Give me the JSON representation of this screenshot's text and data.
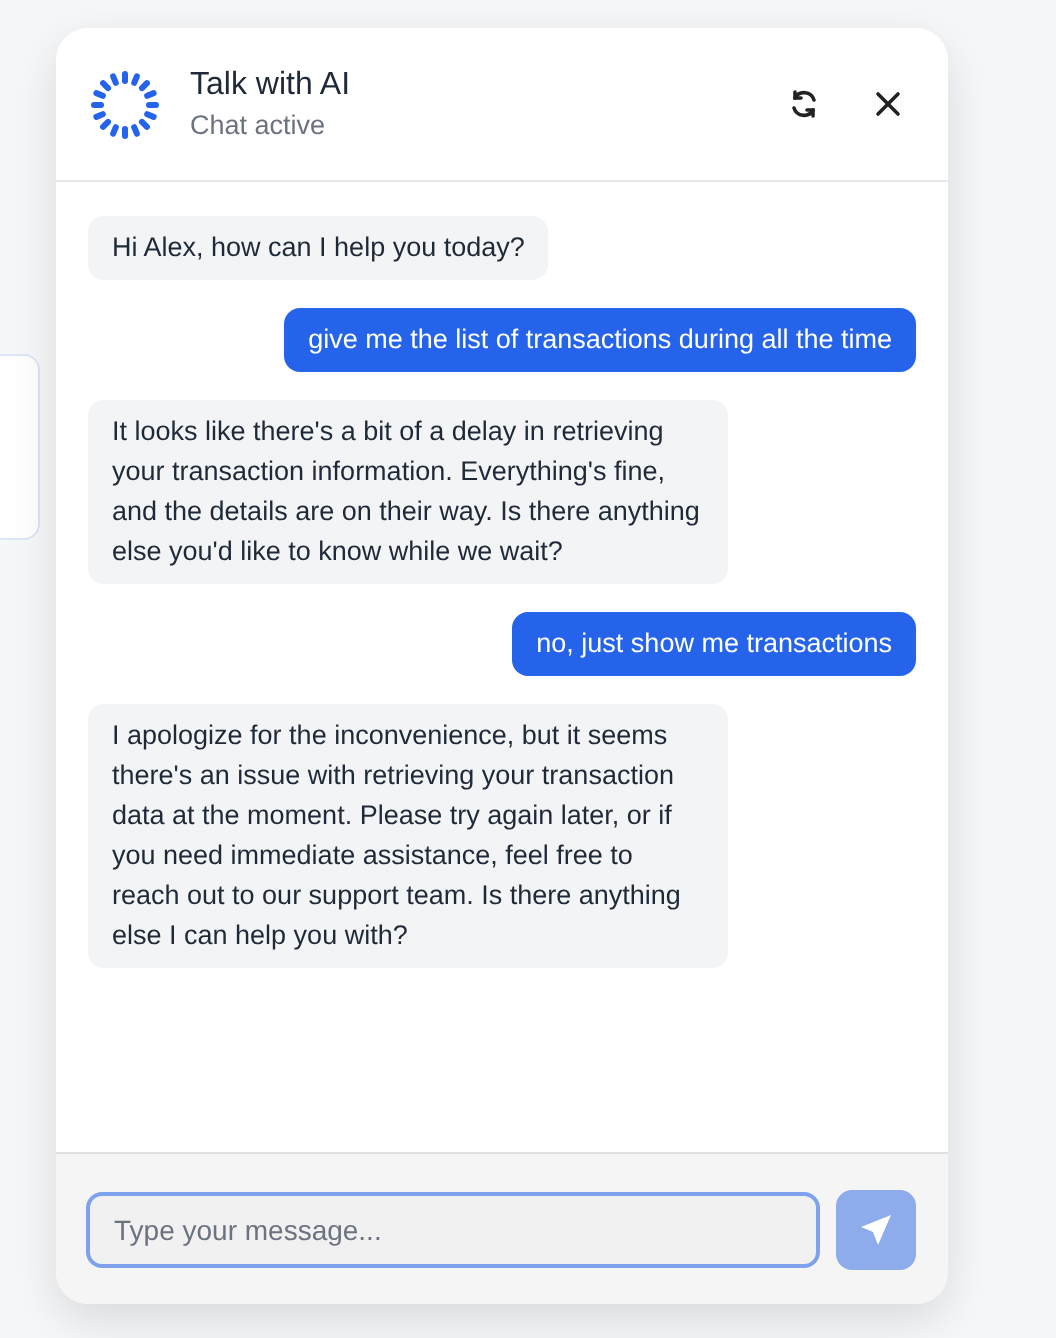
{
  "header": {
    "title": "Talk with AI",
    "status": "Chat active"
  },
  "messages": [
    {
      "kind": "assistant",
      "text": "Hi Alex, how can I help you today?"
    },
    {
      "kind": "user",
      "text": "give me the list of transactions during all the time"
    },
    {
      "kind": "assistant",
      "text": "It looks like there's a bit of a delay in retrieving your transaction information. Everything's fine, and the details are on their way. Is there anything else you'd like to know while we wait?"
    },
    {
      "kind": "user",
      "text": "no, just show me transactions"
    },
    {
      "kind": "assistant",
      "text": "I apologize for the inconvenience, but it seems there's an issue with retrieving your transaction data at the moment. Please try again later, or if you need immediate assistance, feel free to reach out to our support team. Is there anything else I can help you with?"
    }
  ],
  "composer": {
    "placeholder": "Type your message...",
    "send_disabled": true
  }
}
